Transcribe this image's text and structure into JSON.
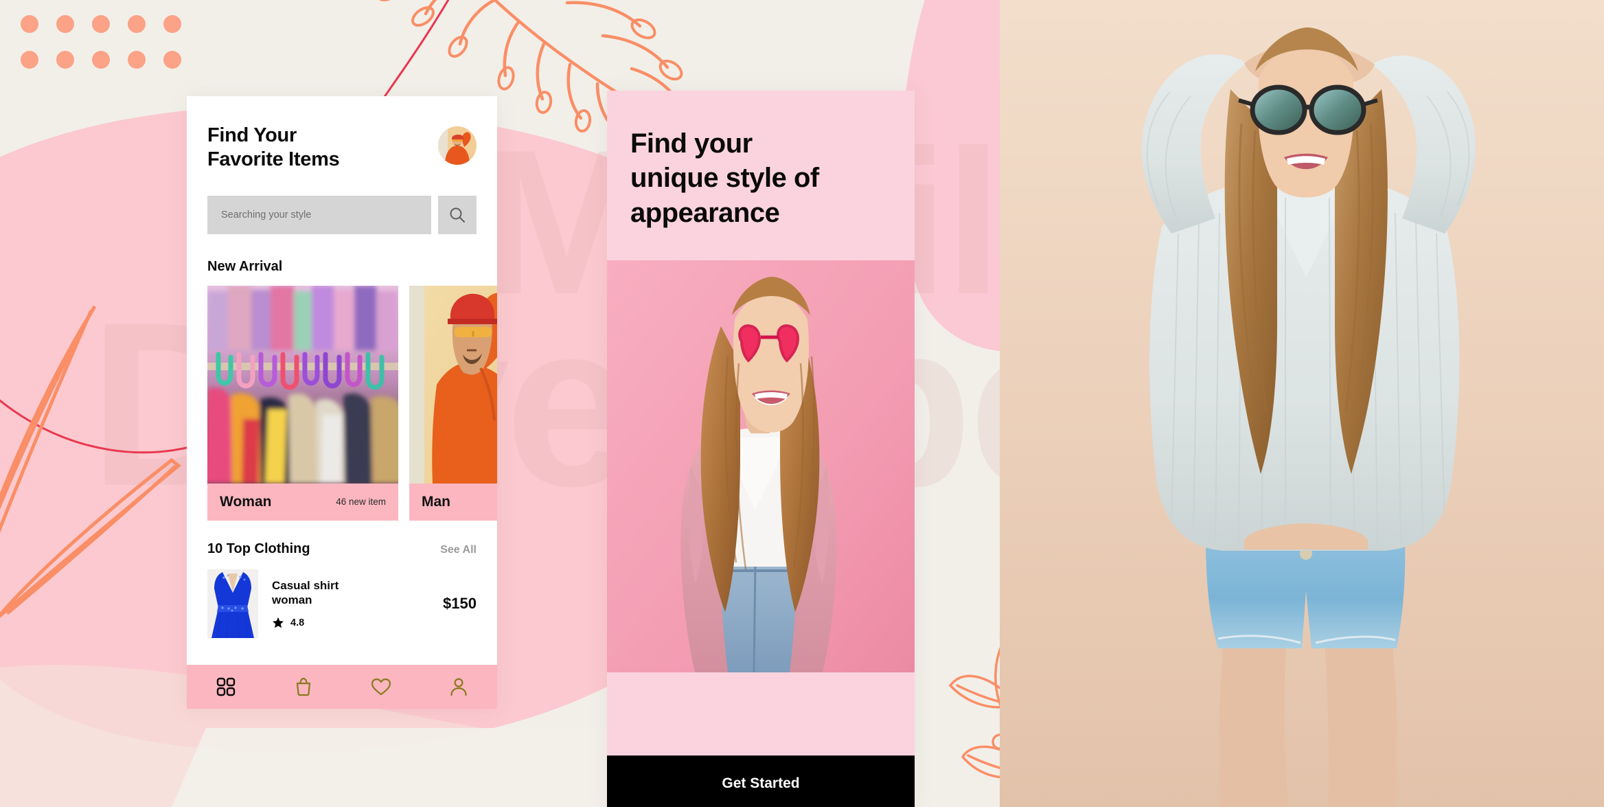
{
  "background": {
    "watermark_top": "Mobile",
    "watermark_bottom": "Developer",
    "canvas_color": "#F2EFE9",
    "accent_salmon": "#FBA287",
    "accent_pink": "#FBD3DE",
    "accent_red": "#E8384F"
  },
  "phone1": {
    "header": {
      "title_line1": "Find Your",
      "title_line2": "Favorite Items",
      "avatar_icon": "user-avatar-photo"
    },
    "search": {
      "placeholder": "Searching your style",
      "value": "",
      "icon": "search-icon"
    },
    "new_arrival": {
      "section_title": "New Arrival",
      "cards": [
        {
          "name": "Woman",
          "count": "46 new item",
          "image": "clothing-rack-photo"
        },
        {
          "name": "Man",
          "count": "",
          "image": "man-orange-shirt-photo"
        }
      ]
    },
    "top_clothing": {
      "section_title": "10 Top Clothing",
      "see_all_label": "See All",
      "products": [
        {
          "name_line1": "Casual shirt",
          "name_line2": "woman",
          "rating": "4.8",
          "price": "$150",
          "thumb": "blue-dress-photo"
        }
      ]
    },
    "tabbar": {
      "items": [
        {
          "icon": "grid-icon",
          "active": true
        },
        {
          "icon": "shopping-bag-icon",
          "active": false
        },
        {
          "icon": "heart-icon",
          "active": false
        },
        {
          "icon": "person-icon",
          "active": false
        }
      ],
      "active_color": "#0A0A0A",
      "inactive_color": "#8A7A1E",
      "bar_color": "#FBB6C0"
    }
  },
  "phone2": {
    "title_line1": "Find your",
    "title_line2": "unique style of",
    "title_line3": "appearance",
    "photo": "woman-pink-sunglasses-photo",
    "cta_label": "Get Started",
    "cta_bg": "#000000"
  },
  "hero": {
    "photo": "woman-sunglasses-denim-shorts-photo"
  },
  "decorations": {
    "dot_grid_top_left": "dot-grid",
    "dot_grid_bottom_right": "dot-grid",
    "branch": "botanical-branch-line-art",
    "leaves": "leaf-line-art",
    "plant": "plant-line-art"
  }
}
